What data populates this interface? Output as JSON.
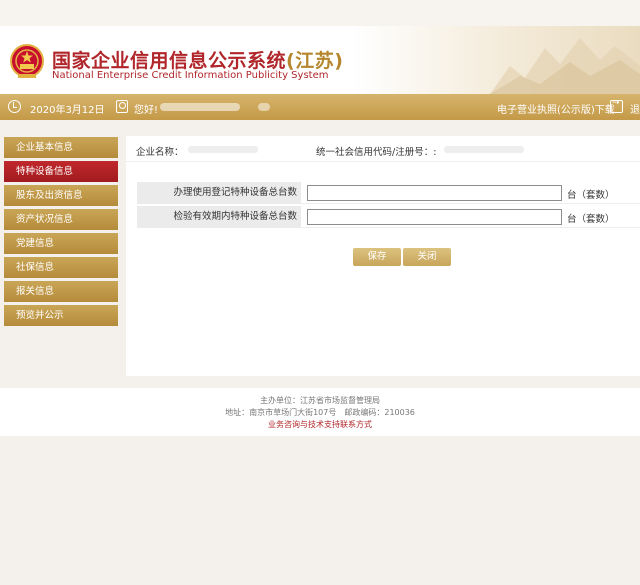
{
  "header": {
    "title_main": "国家企业信用信息公示系统",
    "title_region": "(江苏)",
    "title_en": "National Enterprise Credit Information Publicity System"
  },
  "infobar": {
    "date": "2020年3月12日",
    "welcome": "您好!",
    "download_link": "电子营业执照(公示版)下载",
    "exit_label": "退"
  },
  "sidebar": {
    "items": [
      {
        "label": "企业基本信息",
        "active": false
      },
      {
        "label": "特种设备信息",
        "active": true
      },
      {
        "label": "股东及出资信息",
        "active": false
      },
      {
        "label": "资产状况信息",
        "active": false
      },
      {
        "label": "党建信息",
        "active": false
      },
      {
        "label": "社保信息",
        "active": false
      },
      {
        "label": "报关信息",
        "active": false
      },
      {
        "label": "预览并公示",
        "active": false
      }
    ]
  },
  "content": {
    "enterprise_name_label": "企业名称：",
    "credit_code_label": "统一社会信用代码/注册号：:",
    "rows": [
      {
        "label": "办理使用登记特种设备总台数",
        "value": "",
        "unit": "台（套数）"
      },
      {
        "label": "检验有效期内特种设备总台数",
        "value": "",
        "unit": "台（套数）"
      }
    ],
    "save_label": "保存",
    "close_label": "关闭"
  },
  "footer": {
    "sponsor": "主办单位：江苏省市场监督管理局",
    "address": "地址：南京市草场门大街107号　邮政编码：210036",
    "support": "业务咨询与技术支持联系方式"
  },
  "colors": {
    "brand_red": "#b0262a",
    "gold": "#c49a48",
    "active_red": "#a11b1e"
  }
}
